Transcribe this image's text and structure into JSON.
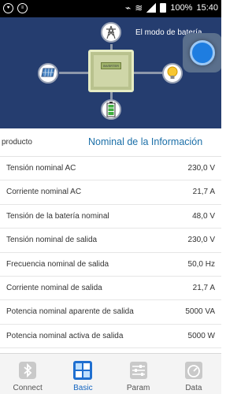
{
  "status_bar": {
    "battery_percent": "100%",
    "time": "15:40"
  },
  "hero": {
    "title": "El modo de batería",
    "inverter_screen_text": "INVERTER"
  },
  "info": {
    "product_label": "producto",
    "section_title": "Nominal de la Información"
  },
  "rows": [
    {
      "label": "Tensión nominal AC",
      "value": "230,0 V"
    },
    {
      "label": "Corriente nominal AC",
      "value": "21,7 A"
    },
    {
      "label": "Tensión de la batería nominal",
      "value": "48,0 V"
    },
    {
      "label": "Tensión nominal de salida",
      "value": "230,0 V"
    },
    {
      "label": "Frecuencia nominal de salida",
      "value": "50,0 Hz"
    },
    {
      "label": "Corriente nominal de salida",
      "value": "21,7 A"
    },
    {
      "label": "Potencia nominal aparente de salida",
      "value": "5000 VA"
    },
    {
      "label": "Potencia nominal activa de salida",
      "value": "5000 W"
    }
  ],
  "tabs": [
    {
      "label": "Connect",
      "icon": "bluetooth-icon",
      "active": false
    },
    {
      "label": "Basic",
      "icon": "dashboard-icon",
      "active": true
    },
    {
      "label": "Param",
      "icon": "sliders-icon",
      "active": false
    },
    {
      "label": "Data",
      "icon": "gauge-icon",
      "active": false
    }
  ],
  "colors": {
    "hero_bg": "#253d6f",
    "accent": "#1b6fa8",
    "active_tab": "#1565c0"
  }
}
